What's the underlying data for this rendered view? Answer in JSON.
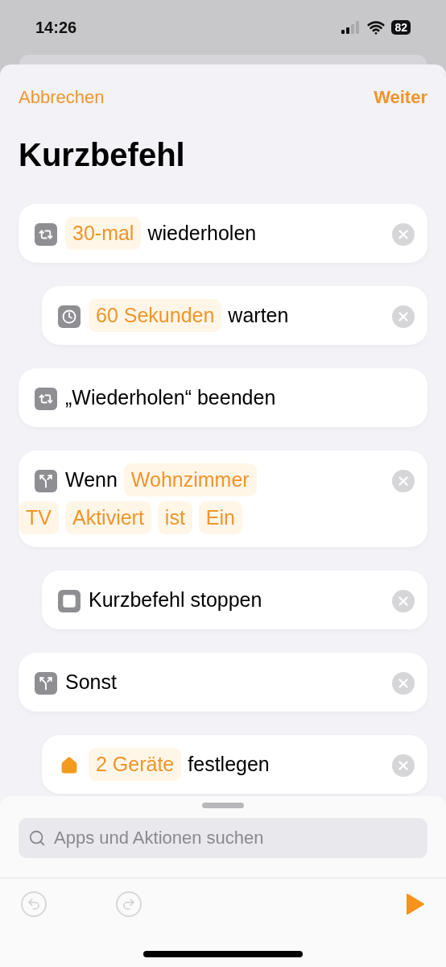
{
  "status_bar": {
    "time": "14:26",
    "battery": "82"
  },
  "nav": {
    "cancel": "Abbrechen",
    "next": "Weiter"
  },
  "title": "Kurzbefehl",
  "actions": [
    {
      "kind": "repeat",
      "removable": true,
      "lines": [
        [
          {
            "kind": "token",
            "text": "30-mal"
          },
          {
            "kind": "word",
            "text": "wiederholen"
          }
        ]
      ],
      "children": [
        {
          "kind": "clock",
          "removable": true,
          "lines": [
            [
              {
                "kind": "token",
                "text": "60 Sekunden"
              },
              {
                "kind": "word",
                "text": "warten"
              }
            ]
          ]
        }
      ]
    },
    {
      "kind": "repeat",
      "removable": false,
      "lines": [
        [
          {
            "kind": "word",
            "text": "„Wiederholen“ beenden"
          }
        ]
      ]
    },
    {
      "kind": "branch",
      "removable": true,
      "lines": [
        [
          {
            "kind": "word",
            "text": "Wenn"
          },
          {
            "kind": "token",
            "text": "Wohnzimmer"
          }
        ],
        [
          {
            "kind": "token",
            "text": "TV"
          },
          {
            "kind": "token",
            "text": "Aktiviert"
          },
          {
            "kind": "token",
            "text": "ist"
          },
          {
            "kind": "token",
            "text": "Ein"
          }
        ]
      ],
      "children": [
        {
          "kind": "stop",
          "removable": true,
          "lines": [
            [
              {
                "kind": "word",
                "text": "Kurzbefehl stoppen"
              }
            ]
          ]
        }
      ]
    },
    {
      "kind": "branch",
      "removable": true,
      "lines": [
        [
          {
            "kind": "word",
            "text": "Sonst"
          }
        ]
      ],
      "children": [
        {
          "kind": "home",
          "removable": true,
          "lines": [
            [
              {
                "kind": "token",
                "text": "2 Geräte"
              },
              {
                "kind": "word",
                "text": "festlegen"
              }
            ]
          ]
        }
      ]
    }
  ],
  "search": {
    "placeholder": "Apps und Aktionen suchen"
  }
}
